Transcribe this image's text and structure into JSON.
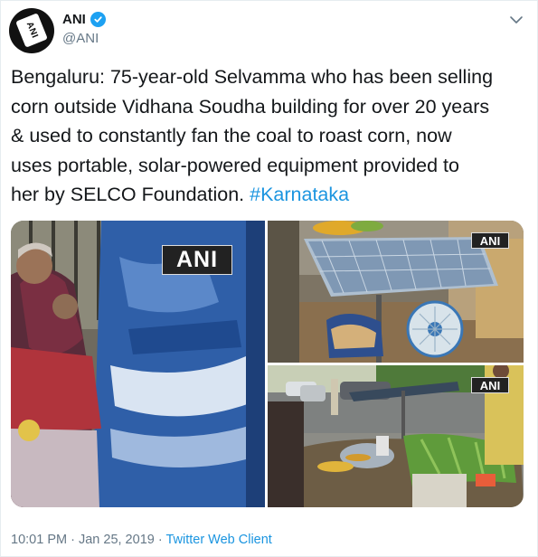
{
  "author": {
    "display_name": "ANI",
    "handle": "@ANI",
    "avatar_logo_text": "ANI",
    "verified": true
  },
  "tweet": {
    "lines": [
      "Bengaluru: 75-year-old Selvamma who has been selling",
      "corn outside Vidhana Soudha building for over 20 years",
      "& used to constantly fan the coal to roast corn, now",
      "uses portable, solar-powered equipment provided to",
      "her by SELCO Foundation. "
    ],
    "hashtag": "#Karnataka"
  },
  "media": {
    "watermark": "ANI"
  },
  "meta": {
    "time": "10:01 PM",
    "separator": " · ",
    "date": "Jan 25, 2019",
    "client": "Twitter Web Client"
  },
  "colors": {
    "link": "#1b95e0",
    "verified": "#1da1f2",
    "secondary_text": "#657786",
    "primary_text": "#14171a"
  },
  "icons": [
    "verified-badge-icon",
    "chevron-down-icon"
  ]
}
